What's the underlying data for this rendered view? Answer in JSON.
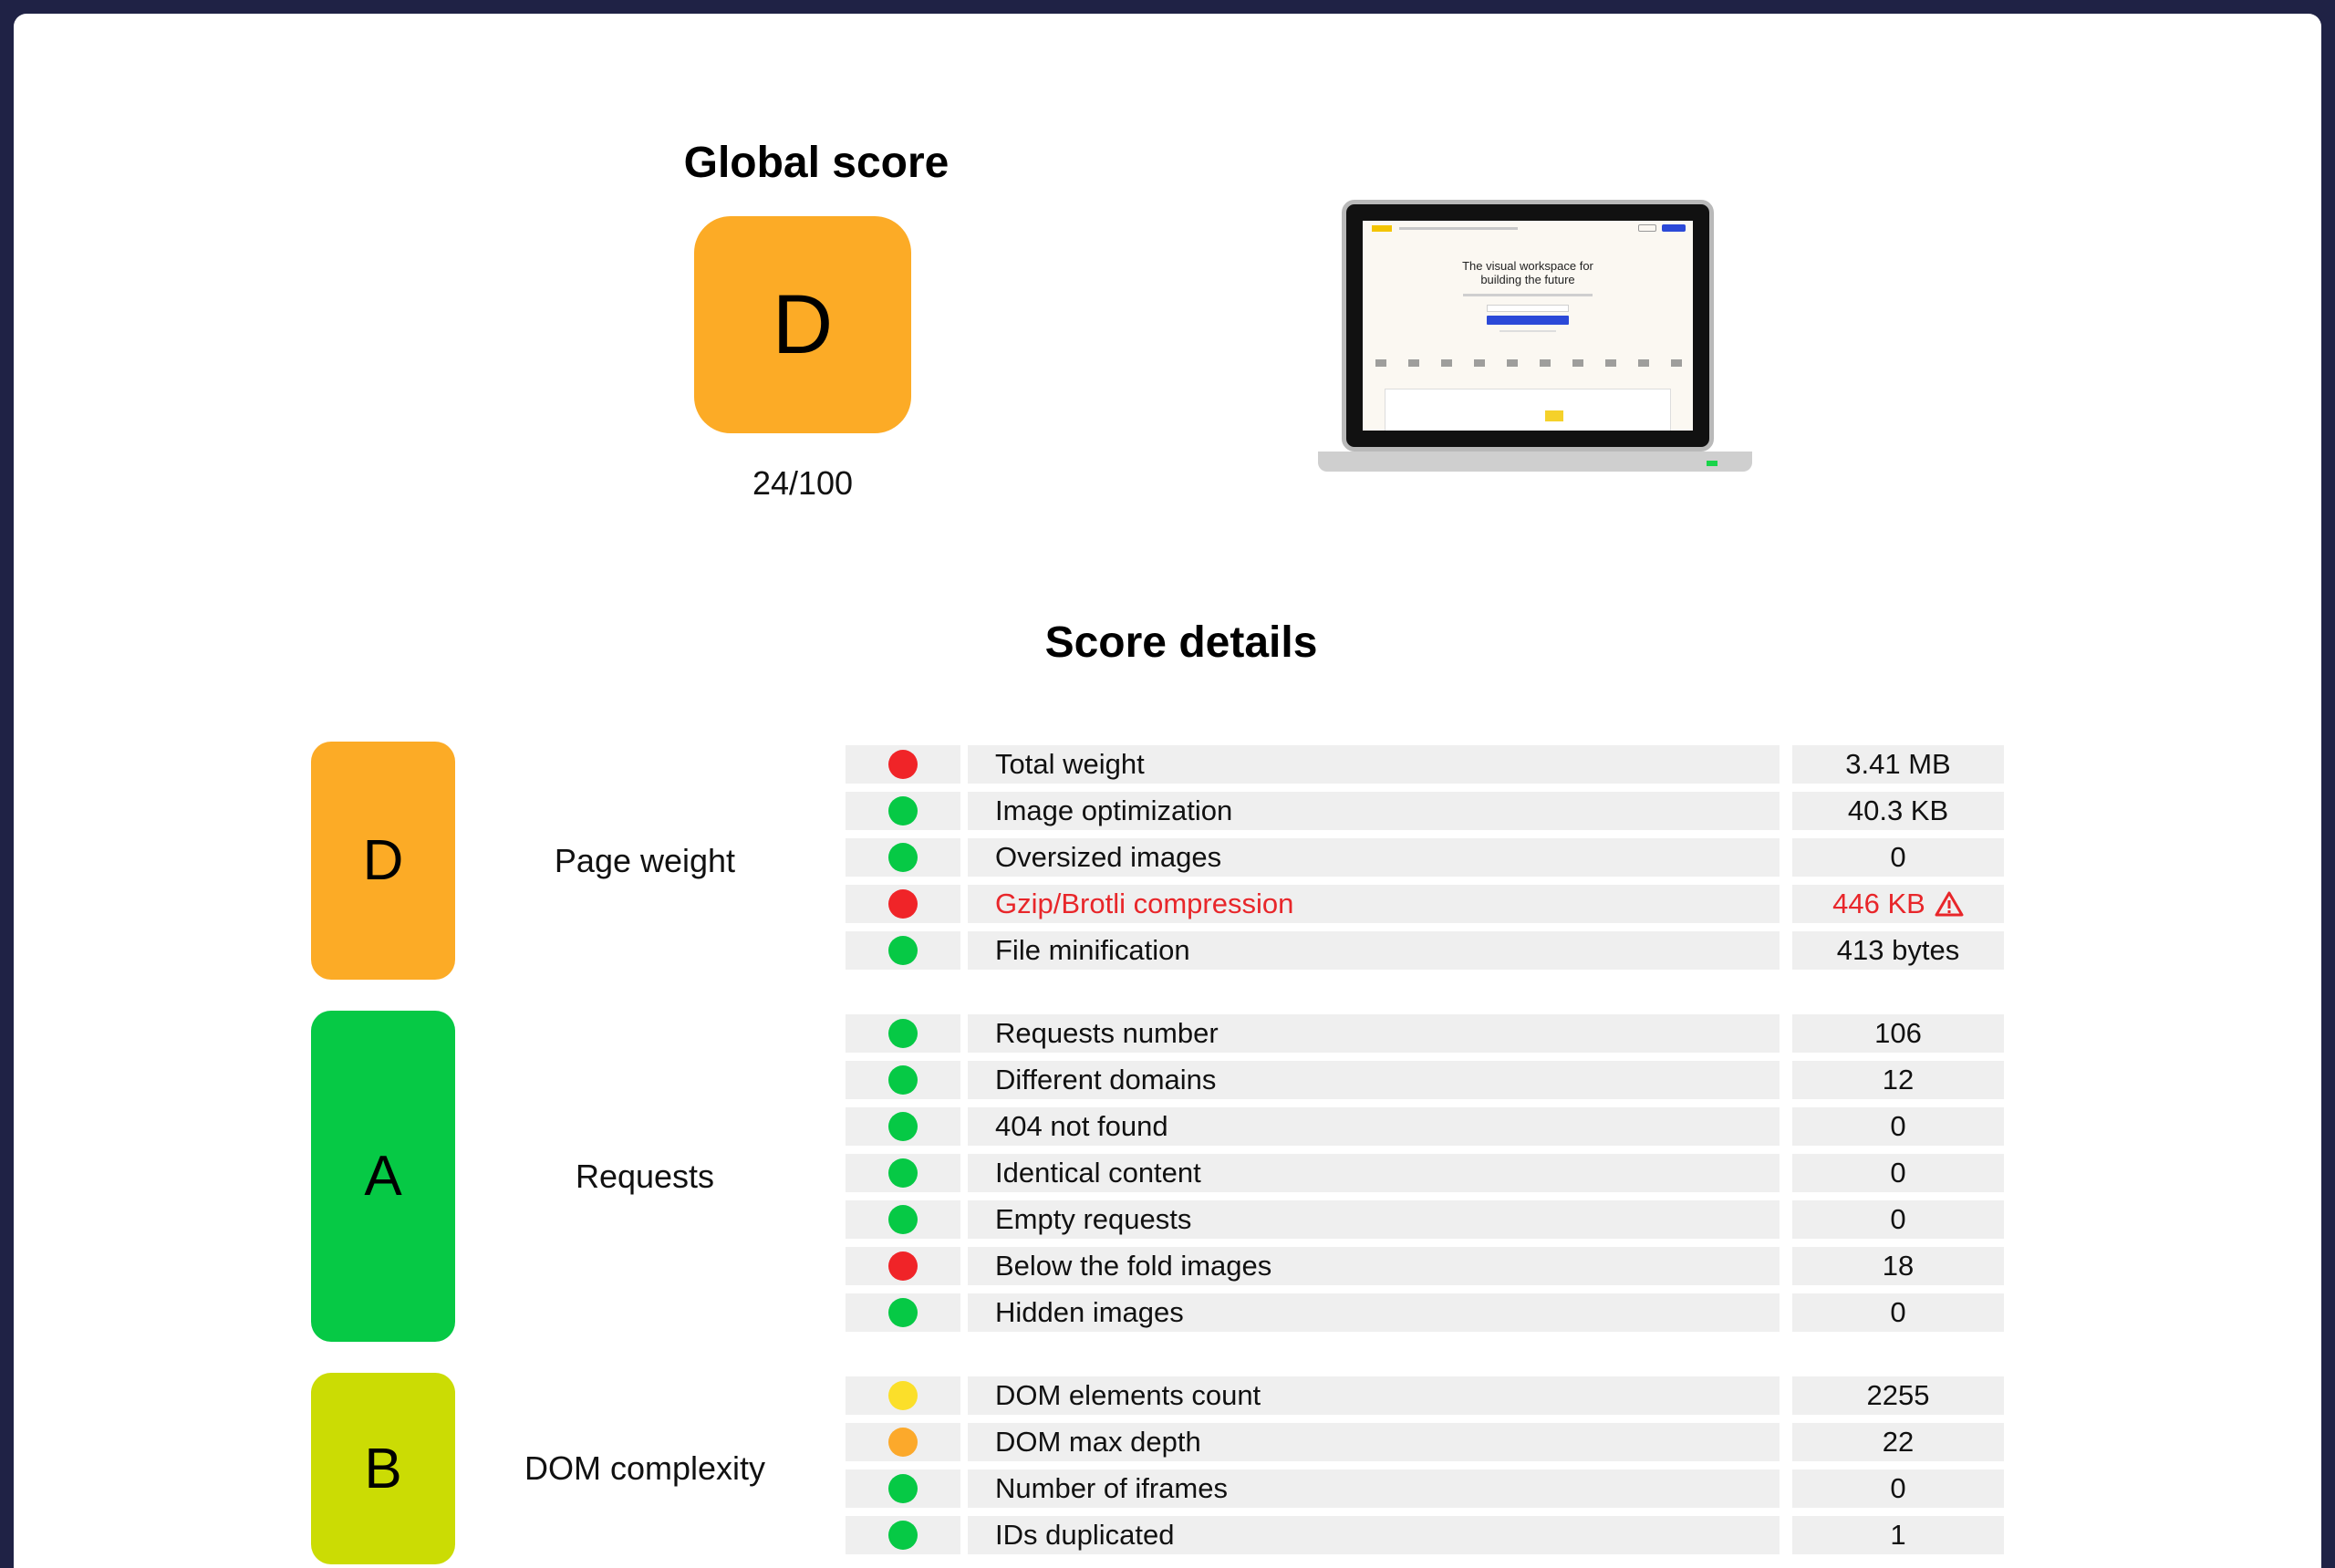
{
  "global": {
    "title": "Global score",
    "grade": "D",
    "value": "24/100"
  },
  "preview": {
    "headline_line1": "The visual workspace for",
    "headline_line2": "building the future"
  },
  "details": {
    "title": "Score details",
    "categories": [
      {
        "grade": "D",
        "label": "Page weight",
        "rows": [
          {
            "name": "Total weight",
            "value": "3.41 MB",
            "status": "red"
          },
          {
            "name": "Image optimization",
            "value": "40.3 KB",
            "status": "green"
          },
          {
            "name": "Oversized images",
            "value": "0",
            "status": "green"
          },
          {
            "name": "Gzip/Brotli compression",
            "value": "446 KB",
            "status": "red",
            "warning": true
          },
          {
            "name": "File minification",
            "value": "413 bytes",
            "status": "green"
          }
        ]
      },
      {
        "grade": "A",
        "label": "Requests",
        "rows": [
          {
            "name": "Requests number",
            "value": "106",
            "status": "green"
          },
          {
            "name": "Different domains",
            "value": "12",
            "status": "green"
          },
          {
            "name": "404 not found",
            "value": "0",
            "status": "green"
          },
          {
            "name": "Identical content",
            "value": "0",
            "status": "green"
          },
          {
            "name": "Empty requests",
            "value": "0",
            "status": "green"
          },
          {
            "name": "Below the fold images",
            "value": "18",
            "status": "red"
          },
          {
            "name": "Hidden images",
            "value": "0",
            "status": "green"
          }
        ]
      },
      {
        "grade": "B",
        "label": "DOM complexity",
        "rows": [
          {
            "name": "DOM elements count",
            "value": "2255",
            "status": "yellow"
          },
          {
            "name": "DOM max depth",
            "value": "22",
            "status": "orange"
          },
          {
            "name": "Number of iframes",
            "value": "0",
            "status": "green"
          },
          {
            "name": "IDs duplicated",
            "value": "1",
            "status": "green"
          }
        ]
      }
    ]
  },
  "colors": {
    "grade_D": "#fcab26",
    "grade_A": "#06c945",
    "grade_B": "#cbdc04",
    "red": "#f02428",
    "green": "#06c945",
    "yellow": "#fbdf2a",
    "orange": "#fca92b",
    "warning_text": "#e8262a"
  },
  "icons": {
    "warning": "warning-triangle-icon"
  }
}
